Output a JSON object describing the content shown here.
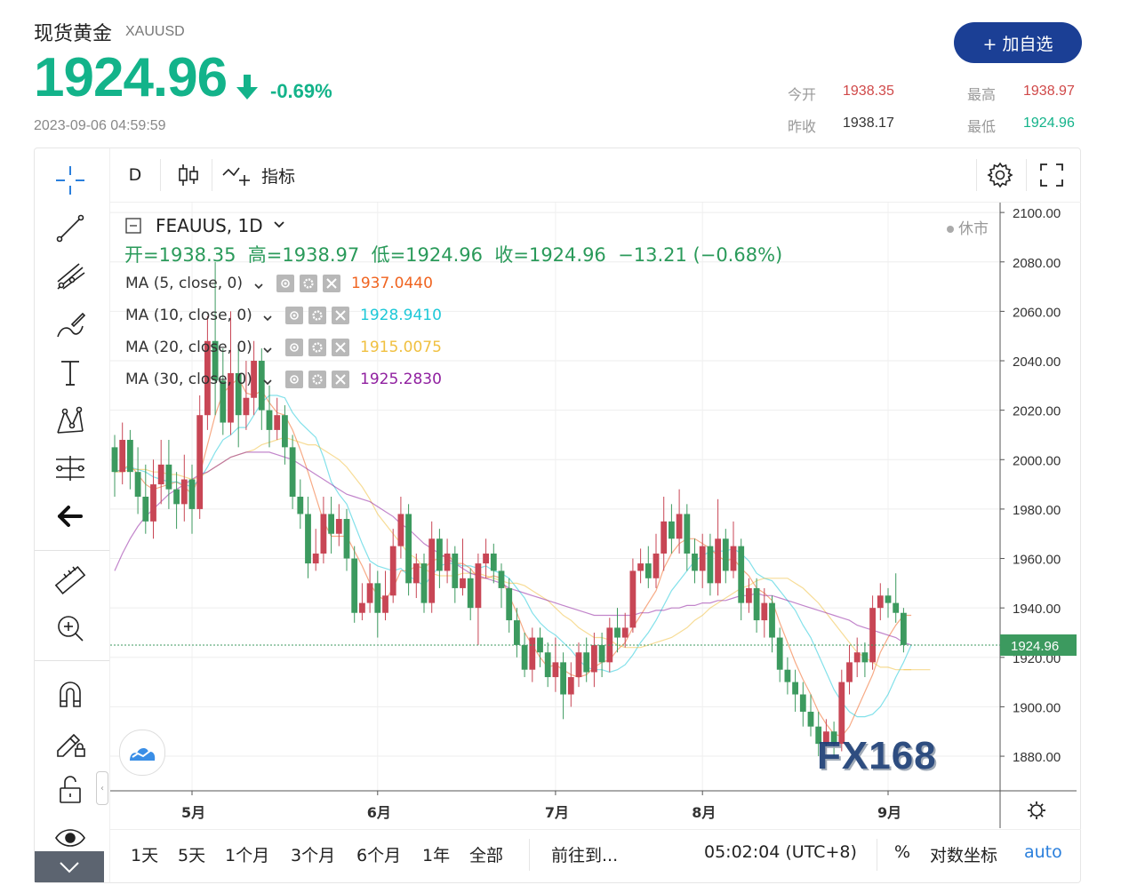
{
  "header": {
    "title": "现货黄金",
    "symbol": "XAUUSD",
    "price": "1924.96",
    "change_pct": "-0.69%",
    "datetime": "2023-09-06 04:59:59",
    "add_button": "+ 加自选",
    "stats": {
      "open_label": "今开",
      "open": "1938.35",
      "high_label": "最高",
      "high": "1938.97",
      "prev_close_label": "昨收",
      "prev_close": "1938.17",
      "low_label": "最低",
      "low": "1924.96"
    }
  },
  "toolbar": {
    "interval": "D",
    "indicators_label": "指标"
  },
  "legend": {
    "title": "FEAUUS, 1D",
    "market_status": "休市",
    "ohlc": "开=1938.35  高=1938.97  低=1924.96  收=1924.96  −13.21 (−0.68%)",
    "ma": [
      {
        "label": "MA (5, close, 0)",
        "value": "1937.0440",
        "color": "#f06420"
      },
      {
        "label": "MA (10, close, 0)",
        "value": "1928.9410",
        "color": "#1ec8d8"
      },
      {
        "label": "MA (20, close, 0)",
        "value": "1915.0075",
        "color": "#f0c040"
      },
      {
        "label": "MA (30, close, 0)",
        "value": "1925.2830",
        "color": "#9020a0"
      }
    ]
  },
  "chart_data": {
    "type": "candlestick",
    "symbol": "FEAUUS",
    "interval": "1D",
    "y_axis_ticks": [
      "2100.00",
      "2080.00",
      "2060.00",
      "2040.00",
      "2020.00",
      "2000.00",
      "1980.00",
      "1960.00",
      "1940.00",
      "1920.00",
      "1900.00",
      "1880.00"
    ],
    "ylim": [
      1866,
      2104
    ],
    "x_labels": [
      "5月",
      "6月",
      "7月",
      "8月",
      "9月"
    ],
    "last_price": "1924.96",
    "up_color": "#c84655",
    "down_color": "#3c9a5f",
    "candles": [
      [
        2005,
        1995,
        2010,
        1985
      ],
      [
        1995,
        2008,
        2015,
        1990
      ],
      [
        2008,
        1995,
        2012,
        1988
      ],
      [
        1995,
        1985,
        2005,
        1978
      ],
      [
        1985,
        1975,
        1998,
        1970
      ],
      [
        1975,
        1990,
        2000,
        1968
      ],
      [
        1990,
        1998,
        2008,
        1982
      ],
      [
        1998,
        1988,
        2008,
        1980
      ],
      [
        1988,
        1982,
        1995,
        1972
      ],
      [
        1982,
        1992,
        2002,
        1975
      ],
      [
        1992,
        1980,
        1998,
        1970
      ],
      [
        1980,
        2018,
        2026,
        1976
      ],
      [
        2018,
        2048,
        2058,
        2012
      ],
      [
        2048,
        2032,
        2080,
        2018
      ],
      [
        2032,
        2015,
        2045,
        2010
      ],
      [
        2015,
        2035,
        2060,
        2010
      ],
      [
        2035,
        2018,
        2045,
        2005
      ],
      [
        2018,
        2025,
        2040,
        2012
      ],
      [
        2025,
        2040,
        2048,
        2018
      ],
      [
        2040,
        2020,
        2045,
        2012
      ],
      [
        2020,
        2012,
        2030,
        2005
      ],
      [
        2012,
        2018,
        2025,
        2008
      ],
      [
        2018,
        2005,
        2022,
        1998
      ],
      [
        2005,
        1985,
        2010,
        1980
      ],
      [
        1985,
        1978,
        1992,
        1972
      ],
      [
        1978,
        1958,
        1985,
        1952
      ],
      [
        1958,
        1962,
        1972,
        1955
      ],
      [
        1962,
        1978,
        1985,
        1958
      ],
      [
        1978,
        1970,
        1985,
        1962
      ],
      [
        1970,
        1976,
        1982,
        1965
      ],
      [
        1976,
        1960,
        1980,
        1955
      ],
      [
        1960,
        1938,
        1965,
        1934
      ],
      [
        1938,
        1942,
        1950,
        1935
      ],
      [
        1942,
        1950,
        1958,
        1938
      ],
      [
        1950,
        1938,
        1955,
        1928
      ],
      [
        1938,
        1945,
        1955,
        1935
      ],
      [
        1945,
        1965,
        1972,
        1942
      ],
      [
        1965,
        1978,
        1985,
        1960
      ],
      [
        1978,
        1950,
        1982,
        1945
      ],
      [
        1950,
        1958,
        1962,
        1944
      ],
      [
        1958,
        1942,
        1962,
        1938
      ],
      [
        1942,
        1968,
        1975,
        1938
      ],
      [
        1968,
        1955,
        1972,
        1948
      ],
      [
        1955,
        1962,
        1968,
        1950
      ],
      [
        1962,
        1948,
        1965,
        1942
      ],
      [
        1948,
        1952,
        1968,
        1945
      ],
      [
        1952,
        1940,
        1956,
        1935
      ],
      [
        1940,
        1958,
        1962,
        1925
      ],
      [
        1958,
        1962,
        1968,
        1952
      ],
      [
        1962,
        1955,
        1966,
        1950
      ],
      [
        1955,
        1948,
        1958,
        1940
      ],
      [
        1948,
        1935,
        1952,
        1930
      ],
      [
        1935,
        1925,
        1940,
        1920
      ],
      [
        1925,
        1915,
        1930,
        1912
      ],
      [
        1915,
        1928,
        1932,
        1910
      ],
      [
        1928,
        1922,
        1932,
        1916
      ],
      [
        1922,
        1912,
        1926,
        1908
      ],
      [
        1912,
        1918,
        1928,
        1906
      ],
      [
        1918,
        1905,
        1922,
        1895
      ],
      [
        1905,
        1912,
        1918,
        1900
      ],
      [
        1912,
        1922,
        1926,
        1908
      ],
      [
        1922,
        1914,
        1928,
        1910
      ],
      [
        1914,
        1925,
        1930,
        1908
      ],
      [
        1925,
        1918,
        1930,
        1912
      ],
      [
        1918,
        1932,
        1936,
        1914
      ],
      [
        1932,
        1928,
        1940,
        1922
      ],
      [
        1928,
        1932,
        1938,
        1924
      ],
      [
        1932,
        1955,
        1960,
        1930
      ],
      [
        1955,
        1958,
        1964,
        1950
      ],
      [
        1958,
        1952,
        1965,
        1948
      ],
      [
        1952,
        1962,
        1970,
        1948
      ],
      [
        1962,
        1975,
        1985,
        1955
      ],
      [
        1975,
        1968,
        1982,
        1962
      ],
      [
        1968,
        1978,
        1988,
        1962
      ],
      [
        1978,
        1962,
        1982,
        1955
      ],
      [
        1962,
        1955,
        1968,
        1950
      ],
      [
        1955,
        1965,
        1970,
        1948
      ],
      [
        1965,
        1950,
        1970,
        1945
      ],
      [
        1950,
        1968,
        1984,
        1945
      ],
      [
        1968,
        1955,
        1972,
        1950
      ],
      [
        1955,
        1965,
        1975,
        1952
      ],
      [
        1965,
        1942,
        1968,
        1935
      ],
      [
        1942,
        1948,
        1952,
        1938
      ],
      [
        1948,
        1935,
        1952,
        1930
      ],
      [
        1935,
        1942,
        1948,
        1928
      ],
      [
        1942,
        1928,
        1945,
        1922
      ],
      [
        1928,
        1915,
        1932,
        1910
      ],
      [
        1915,
        1910,
        1920,
        1905
      ],
      [
        1910,
        1905,
        1915,
        1898
      ],
      [
        1905,
        1898,
        1910,
        1892
      ],
      [
        1898,
        1892,
        1905,
        1888
      ],
      [
        1892,
        1885,
        1898,
        1880
      ],
      [
        1885,
        1890,
        1895,
        1882
      ],
      [
        1890,
        1885,
        1894,
        1880
      ],
      [
        1885,
        1910,
        1915,
        1882
      ],
      [
        1910,
        1918,
        1925,
        1905
      ],
      [
        1918,
        1922,
        1928,
        1912
      ],
      [
        1922,
        1918,
        1926,
        1912
      ],
      [
        1918,
        1940,
        1945,
        1915
      ],
      [
        1940,
        1945,
        1950,
        1935
      ],
      [
        1945,
        1942,
        1948,
        1936
      ],
      [
        1942,
        1938,
        1954,
        1934
      ],
      [
        1938,
        1925,
        1940,
        1922
      ]
    ],
    "series": [
      {
        "name": "MA (5, close, 0)",
        "color": "#f06420",
        "values": [
          1995,
          1996,
          1998,
          1994,
          1990,
          1988,
          1989,
          1990,
          1991,
          1989,
          1986,
          1994,
          2006,
          2018,
          2027,
          2030,
          2033,
          2027,
          2026,
          2028,
          2023,
          2019,
          2018,
          2012,
          2004,
          1995,
          1985,
          1975,
          1969,
          1969,
          1969,
          1963,
          1957,
          1950,
          1945,
          1943,
          1948,
          1955,
          1955,
          1957,
          1956,
          1959,
          1960,
          1962,
          1958,
          1958,
          1956,
          1952,
          1952,
          1953,
          1952,
          1945,
          1938,
          1930,
          1925,
          1920,
          1916,
          1917,
          1915,
          1913,
          1912,
          1913,
          1916,
          1918,
          1919,
          1923,
          1926,
          1932,
          1937,
          1942,
          1947,
          1956,
          1962,
          1966,
          1968,
          1968,
          1966,
          1964,
          1961,
          1959,
          1960,
          1956,
          1953,
          1948,
          1946,
          1943,
          1934,
          1926,
          1918,
          1911,
          1905,
          1898,
          1893,
          1889,
          1888,
          1892,
          1899,
          1906,
          1913,
          1922,
          1928,
          1933,
          1937,
          1937
        ]
      },
      {
        "name": "MA (10, close, 0)",
        "color": "#1ec8d8",
        "values": [
          1995,
          1996,
          1997,
          1996,
          1995,
          1993,
          1992,
          1991,
          1991,
          1990,
          1989,
          1992,
          1997,
          2003,
          2008,
          2010,
          2013,
          2013,
          2018,
          2023,
          2026,
          2026,
          2025,
          2019,
          2015,
          2012,
          2009,
          2001,
          1991,
          1986,
          1982,
          1974,
          1966,
          1959,
          1957,
          1956,
          1955,
          1956,
          1953,
          1951,
          1949,
          1953,
          1957,
          1958,
          1958,
          1957,
          1957,
          1956,
          1957,
          1955,
          1954,
          1952,
          1948,
          1944,
          1938,
          1934,
          1931,
          1929,
          1926,
          1923,
          1919,
          1916,
          1915,
          1915,
          1914,
          1915,
          1917,
          1921,
          1926,
          1930,
          1935,
          1941,
          1947,
          1951,
          1955,
          1959,
          1961,
          1963,
          1963,
          1963,
          1964,
          1962,
          1959,
          1954,
          1952,
          1951,
          1947,
          1943,
          1939,
          1933,
          1928,
          1921,
          1914,
          1907,
          1902,
          1898,
          1896,
          1896,
          1897,
          1900,
          1905,
          1912,
          1918,
          1925
        ]
      },
      {
        "name": "MA (20, close, 0)",
        "color": "#f0c040",
        "values": [
          1995,
          1995,
          1996,
          1996,
          1996,
          1995,
          1995,
          1994,
          1994,
          1993,
          1992,
          1993,
          1995,
          1997,
          1999,
          2001,
          2002,
          2003,
          2004,
          2006,
          2007,
          2008,
          2009,
          2008,
          2007,
          2006,
          2006,
          2004,
          2002,
          2000,
          1997,
          1993,
          1989,
          1984,
          1978,
          1974,
          1970,
          1966,
          1962,
          1960,
          1956,
          1954,
          1953,
          1953,
          1953,
          1954,
          1954,
          1954,
          1953,
          1952,
          1951,
          1950,
          1950,
          1949,
          1947,
          1945,
          1943,
          1940,
          1937,
          1935,
          1932,
          1930,
          1928,
          1928,
          1927,
          1925,
          1924,
          1924,
          1924,
          1925,
          1926,
          1927,
          1928,
          1930,
          1932,
          1935,
          1937,
          1940,
          1942,
          1944,
          1946,
          1948,
          1949,
          1951,
          1952,
          1952,
          1952,
          1952,
          1950,
          1948,
          1945,
          1942,
          1938,
          1934,
          1930,
          1926,
          1922,
          1920,
          1918,
          1916,
          1916,
          1915,
          1915,
          1915
        ]
      },
      {
        "name": "MA (30, close, 0)",
        "color": "#9020a0",
        "values": [
          1955,
          1962,
          1968,
          1973,
          1977,
          1980,
          1983,
          1986,
          1988,
          1990,
          1992,
          1994,
          1995,
          1997,
          1999,
          2001,
          2002,
          2003,
          2003,
          2003,
          2003,
          2002,
          2001,
          2000,
          1998,
          1996,
          1994,
          1992,
          1990,
          1988,
          1986,
          1985,
          1984,
          1983,
          1981,
          1979,
          1977,
          1974,
          1972,
          1969,
          1966,
          1964,
          1962,
          1960,
          1958,
          1956,
          1954,
          1953,
          1952,
          1951,
          1950,
          1948,
          1947,
          1946,
          1945,
          1944,
          1943,
          1942,
          1941,
          1940,
          1939,
          1938,
          1937,
          1937,
          1937,
          1937,
          1937,
          1937,
          1938,
          1938,
          1939,
          1939,
          1940,
          1940,
          1941,
          1941,
          1942,
          1942,
          1943,
          1943,
          1944,
          1945,
          1945,
          1946,
          1945,
          1945,
          1944,
          1943,
          1942,
          1941,
          1940,
          1939,
          1938,
          1937,
          1936,
          1935,
          1933,
          1932,
          1931,
          1930,
          1929,
          1928,
          1926,
          1925
        ]
      }
    ]
  },
  "bottom": {
    "ranges": [
      "1天",
      "5天",
      "1个月",
      "3个月",
      "6个月",
      "1年",
      "全部"
    ],
    "goto": "前往到...",
    "time": "05:02:04 (UTC+8)",
    "percent": "%",
    "log": "对数坐标",
    "auto": "auto"
  },
  "watermark": "FX168"
}
